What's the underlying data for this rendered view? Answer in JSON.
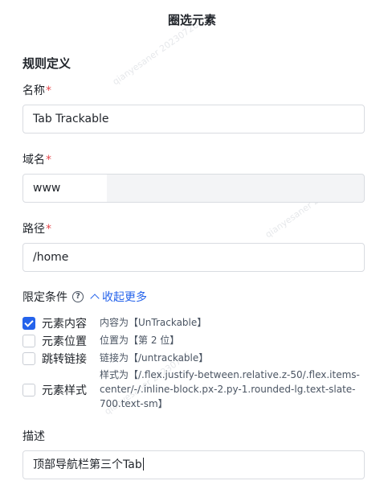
{
  "header": {
    "title": "圈选元素"
  },
  "section": {
    "title": "规则定义"
  },
  "name_field": {
    "label": "名称",
    "required_mark": "*",
    "value": "Tab Trackable"
  },
  "domain_field": {
    "label": "域名",
    "required_mark": "*",
    "prefix_value": "www",
    "value": ""
  },
  "path_field": {
    "label": "路径",
    "required_mark": "*",
    "value": "/home"
  },
  "conditions": {
    "label": "限定条件",
    "help_icon": "question-circle-icon",
    "help_glyph": "?",
    "collapse_label": "收起更多",
    "collapse_icon": "chevron-up-icon",
    "options": [
      {
        "label": "元素内容",
        "checked": true,
        "desc": "内容为【UnTrackable】"
      },
      {
        "label": "元素位置",
        "checked": false,
        "desc": "位置为【第 2 位】"
      },
      {
        "label": "跳转链接",
        "checked": false,
        "desc": "链接为【/untrackable】"
      },
      {
        "label": "元素样式",
        "checked": false,
        "desc_lines": [
          "样式为【/.flex.justify-between.relative.z-50/.flex.items-",
          "center/-/.inline-block.px-2.py-1.rounded-lg.text-slate-",
          "700.text-sm】"
        ]
      }
    ]
  },
  "description_field": {
    "label": "描述",
    "value": "顶部导航栏第三个Tab"
  },
  "colors": {
    "accent": "#2563eb",
    "required": "#e5484d",
    "border": "#d9dce1",
    "disabled_bg": "#f3f4f6"
  }
}
